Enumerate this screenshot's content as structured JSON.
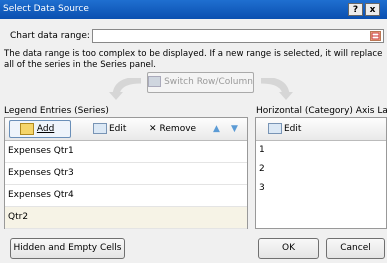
{
  "window": {
    "title": "Select Data Source",
    "help_glyph": "?",
    "close_glyph": "x"
  },
  "range": {
    "label": "Chart data range:",
    "value": ""
  },
  "message": "The data range is too complex to be displayed. If a new range is selected, it will replace all of the series in the Series panel.",
  "switch_button": "Switch Row/Column",
  "legend": {
    "heading": "Legend Entries (Series)",
    "add": "Add",
    "edit": "Edit",
    "remove": "Remove",
    "series": [
      "Expenses Qtr1",
      "Expenses Qtr3",
      "Expenses Qtr4",
      "Qtr2"
    ],
    "selected_index": 3
  },
  "axis": {
    "heading": "Horizontal (Category) Axis Labels",
    "edit": "Edit",
    "labels": [
      "1",
      "2",
      "3"
    ]
  },
  "footer": {
    "hidden_cells": "Hidden and Empty Cells",
    "ok": "OK",
    "cancel": "Cancel"
  },
  "icons": {
    "range_picker": "range-collapse-icon",
    "add": "add-series-icon",
    "edit": "edit-pencil-icon",
    "remove": "remove-x-icon",
    "up": "move-up-icon",
    "down": "move-down-icon"
  },
  "colors": {
    "title_bar": "#0a4fb0",
    "selected_row": "#f6f3e6",
    "arrows_disabled": "#5b9bd5"
  }
}
